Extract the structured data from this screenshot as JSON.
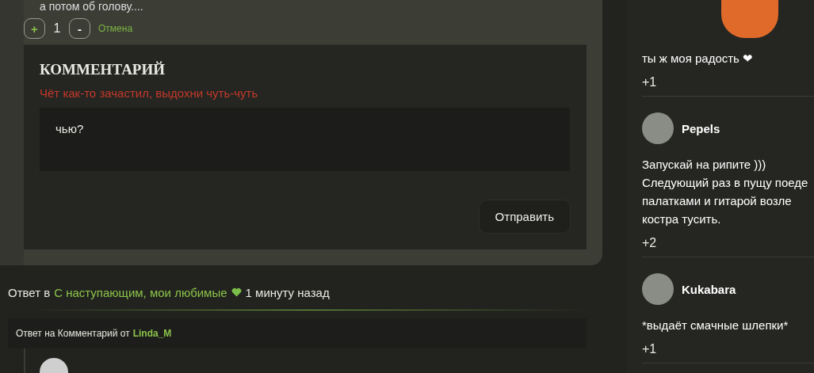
{
  "post": {
    "text": "а потом об голову....",
    "votes": {
      "plus": "+",
      "count": "1",
      "minus": "-",
      "cancel": "Отмена"
    }
  },
  "comment_form": {
    "title": "КОММЕНТАРИЙ",
    "warning": "Чёт как-то зачастил, выдохни чуть-чуть",
    "value": "чью?",
    "submit": "Отправить"
  },
  "reply_line": {
    "prefix": "Ответ в",
    "link": "С наступающим, мои любимые",
    "time": "1 минуту назад"
  },
  "reply_to": {
    "prefix": "Ответ на Комментарий от",
    "author": "Linda_M"
  },
  "sidebar": {
    "comments": [
      {
        "kind": "sticker",
        "lines": [
          "ты ж моя радость ❤"
        ],
        "score": "+1"
      },
      {
        "kind": "user",
        "author": "Pepels",
        "lines": [
          "Запускай на рипите )))",
          "Следующий раз в пущу поеде",
          "палатками и гитарой возле",
          "костра тусить."
        ],
        "score": "+2"
      },
      {
        "kind": "user",
        "author": "Kukabara",
        "lines": [
          "*выдаёт смачные шлепки*"
        ],
        "score": "+1"
      }
    ]
  }
}
